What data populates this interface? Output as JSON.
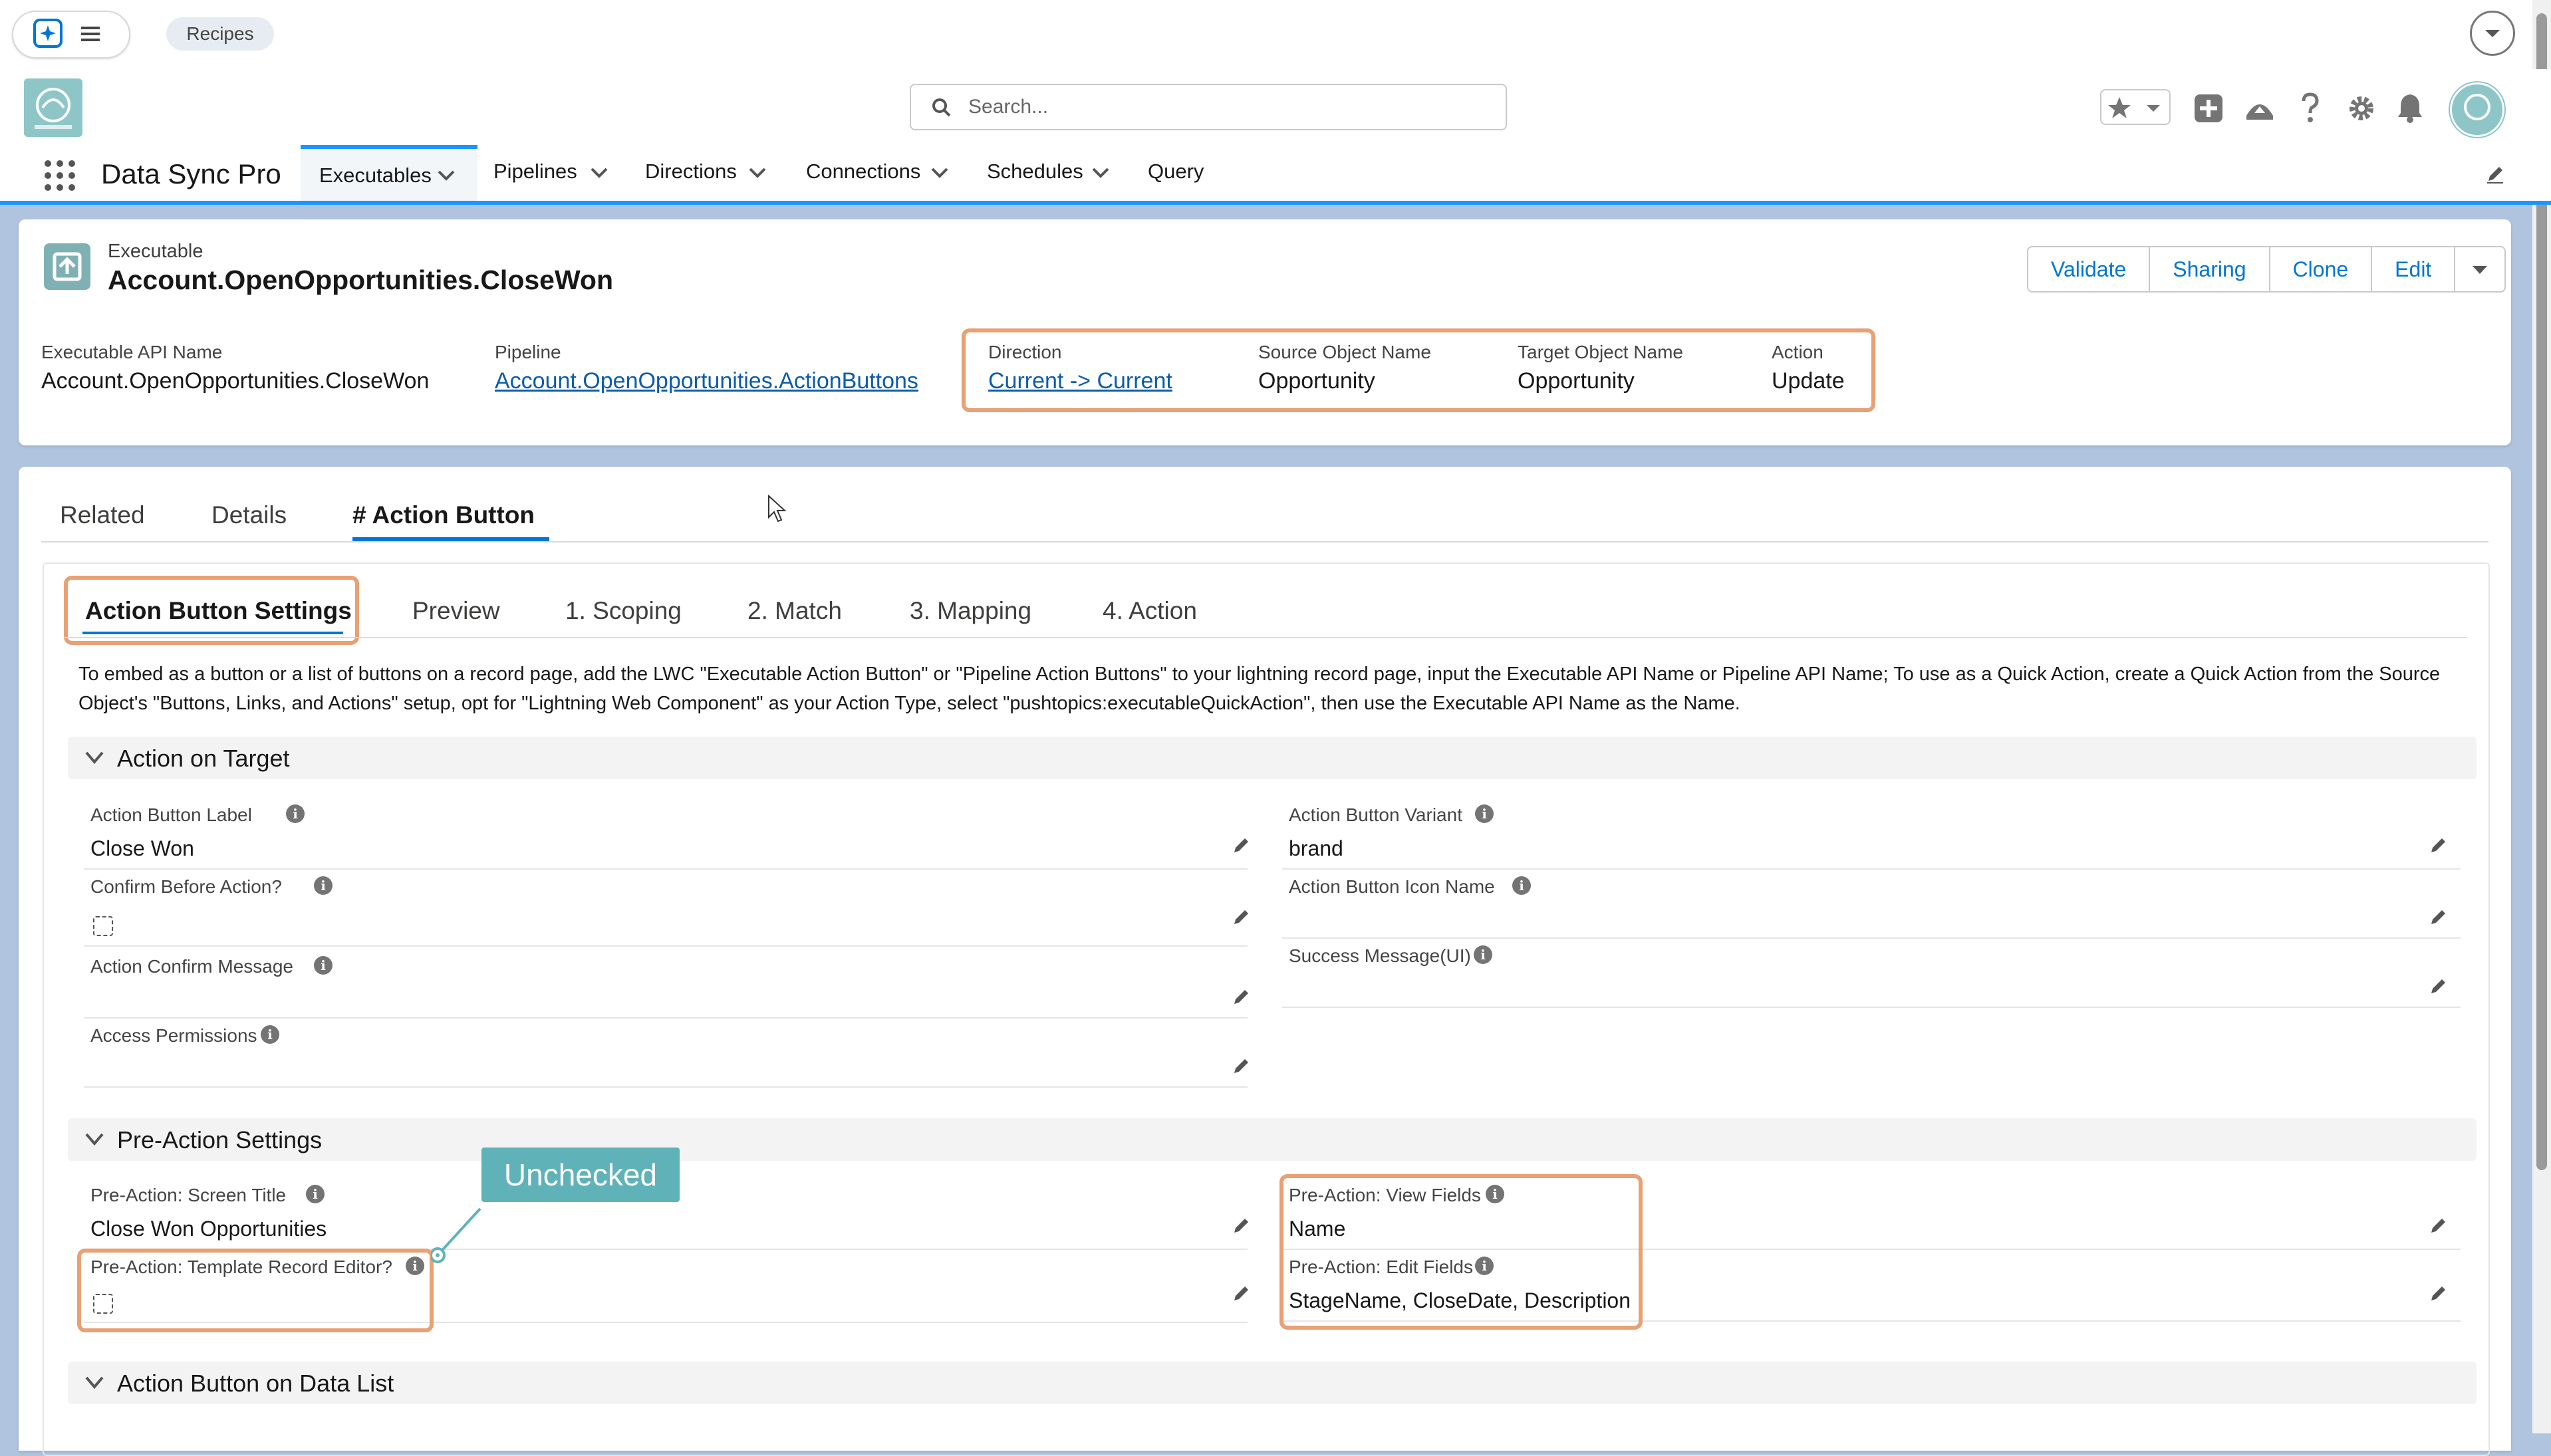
{
  "topbar": {
    "recipes_label": "Recipes"
  },
  "header": {
    "search_placeholder": "Search..."
  },
  "nav": {
    "app_name": "Data Sync Pro",
    "tabs": [
      {
        "label": "Executables",
        "dropdown": true,
        "active": true
      },
      {
        "label": "Pipelines",
        "dropdown": true
      },
      {
        "label": "Directions",
        "dropdown": true
      },
      {
        "label": "Connections",
        "dropdown": true
      },
      {
        "label": "Schedules",
        "dropdown": true
      },
      {
        "label": "Query",
        "dropdown": false
      }
    ]
  },
  "record": {
    "object_type": "Executable",
    "title": "Account.OpenOpportunities.CloseWon",
    "buttons": [
      "Validate",
      "Sharing",
      "Clone",
      "Edit"
    ],
    "highlights": [
      {
        "label": "Executable API Name",
        "value": "Account.OpenOpportunities.CloseWon",
        "link": false
      },
      {
        "label": "Pipeline",
        "value": "Account.OpenOpportunities.ActionButtons",
        "link": true
      },
      {
        "label": "Direction",
        "value": "Current -> Current",
        "link": true
      },
      {
        "label": "Source Object Name",
        "value": "Opportunity",
        "link": false
      },
      {
        "label": "Target Object Name",
        "value": "Opportunity",
        "link": false
      },
      {
        "label": "Action",
        "value": "Update",
        "link": false
      }
    ]
  },
  "tabs": [
    "Related",
    "Details",
    "# Action Button"
  ],
  "subtabs": [
    "Action Button Settings",
    "Preview",
    "1. Scoping",
    "2. Match",
    "3. Mapping",
    "4. Action"
  ],
  "instructions": "To embed as a button or a list of buttons on a record page, add the LWC \"Executable Action Button\" or \"Pipeline Action Buttons\" to your lightning record page, input the Executable API Name or Pipeline API Name; To use as a Quick Action, create a Quick Action from the Source Object's \"Buttons, Links, and Actions\" setup, opt for \"Lightning Web Component\" as your Action Type, select \"pushtopics:executableQuickAction\", then use the Executable API Name as the Name.",
  "instructions_line1": "To embed as a button or a list of buttons on a record page, add the LWC \"Executable Action Button\" or \"Pipeline Action Buttons\" to your lightning record page, input the Executable API Name or Pipeline API Name; To use as a Quick Action, create a Quick Action from the Source",
  "instructions_line2": "Object's \"Buttons, Links, and Actions\" setup, opt for \"Lightning Web Component\" as your Action Type, select \"pushtopics:executableQuickAction\", then use the Executable API Name as the Name.",
  "sections": {
    "action_on_target": {
      "title": "Action on Target",
      "left": [
        {
          "label": "Action Button Label",
          "value": "Close Won"
        },
        {
          "label": "Confirm Before Action?",
          "checkbox": true,
          "checked": false
        },
        {
          "label": "Action Confirm Message",
          "value": ""
        },
        {
          "label": "Access Permissions",
          "value": ""
        }
      ],
      "right": [
        {
          "label": "Action Button Variant",
          "value": "brand"
        },
        {
          "label": "Action Button Icon Name",
          "value": ""
        },
        {
          "label": "Success Message(UI)",
          "value": ""
        }
      ]
    },
    "pre_action": {
      "title": "Pre-Action Settings",
      "left": [
        {
          "label": "Pre-Action: Screen Title",
          "value": "Close Won Opportunities"
        },
        {
          "label": "Pre-Action: Template Record Editor?",
          "checkbox": true,
          "checked": false
        }
      ],
      "right": [
        {
          "label": "Pre-Action: View Fields",
          "value": "Name"
        },
        {
          "label": "Pre-Action: Edit Fields",
          "value": "StageName, CloseDate, Description"
        }
      ]
    },
    "data_list": {
      "title": "Action Button on Data List"
    }
  },
  "callout": {
    "text": "Unchecked",
    "color": "#5fb3b8"
  },
  "colors": {
    "highlight_border": "#e8a074",
    "brand_blue": "#0176d3",
    "background": "#b0c4df"
  },
  "icons": [
    "agentforce-icon",
    "menu-icon",
    "search-icon",
    "favorites-star-icon",
    "add-icon",
    "trailhead-icon",
    "help-icon",
    "settings-gear-icon",
    "notification-bell-icon",
    "avatar",
    "app-launcher-icon",
    "pencil-icon",
    "info-icon",
    "chevron-down-icon",
    "cursor-icon"
  ]
}
